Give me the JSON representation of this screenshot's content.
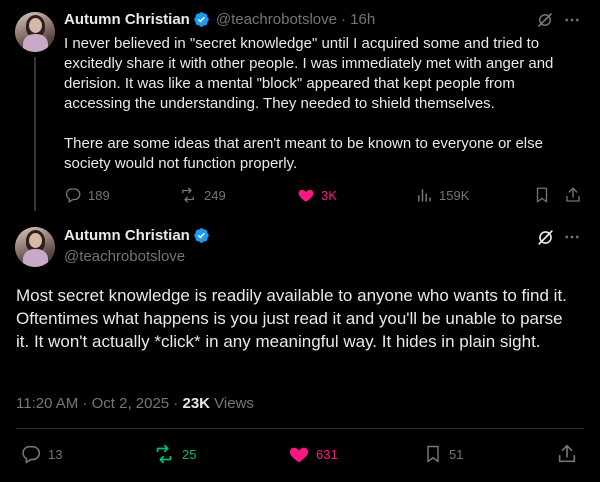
{
  "parent_tweet": {
    "author_name": "Autumn Christian",
    "handle": "@teachrobotslove",
    "time": "· 16h",
    "text_p1": "I never believed in \"secret knowledge\" until I acquired some and tried to excitedly share it with other people. I was immediately met with anger and derision. It was like a mental \"block\" appeared that kept people from accessing the understanding. They needed to shield themselves.",
    "text_p2": "There are some ideas that aren't meant to be known to everyone or else society would not function properly.",
    "replies": "189",
    "reposts": "249",
    "likes": "3K",
    "views": "159K"
  },
  "main_tweet": {
    "author_name": "Autumn Christian",
    "handle": "@teachrobotslove",
    "text": "Most secret knowledge is readily available to anyone who wants to find it. Oftentimes what happens is you just read it and you'll be unable to parse it. It won't actually *click* in any meaningful way. It hides in plain sight.",
    "timestamp": "11:20 AM · Oct 2, 2025 · ",
    "views_count": "23K",
    "views_label": " Views",
    "replies": "13",
    "reposts": "25",
    "likes": "631",
    "bookmarks": "51"
  },
  "colors": {
    "background": "#000000",
    "text": "#e7e9ea",
    "muted": "#71767b",
    "verified": "#1d9bf0",
    "like_pink": "#f91880",
    "repost_green": "#00ba7c",
    "divider": "#2f3336"
  },
  "icons": [
    "verified-badge-icon",
    "grok-icon",
    "more-icon",
    "reply-icon",
    "repost-icon",
    "like-icon",
    "views-icon",
    "bookmark-icon",
    "share-icon"
  ]
}
